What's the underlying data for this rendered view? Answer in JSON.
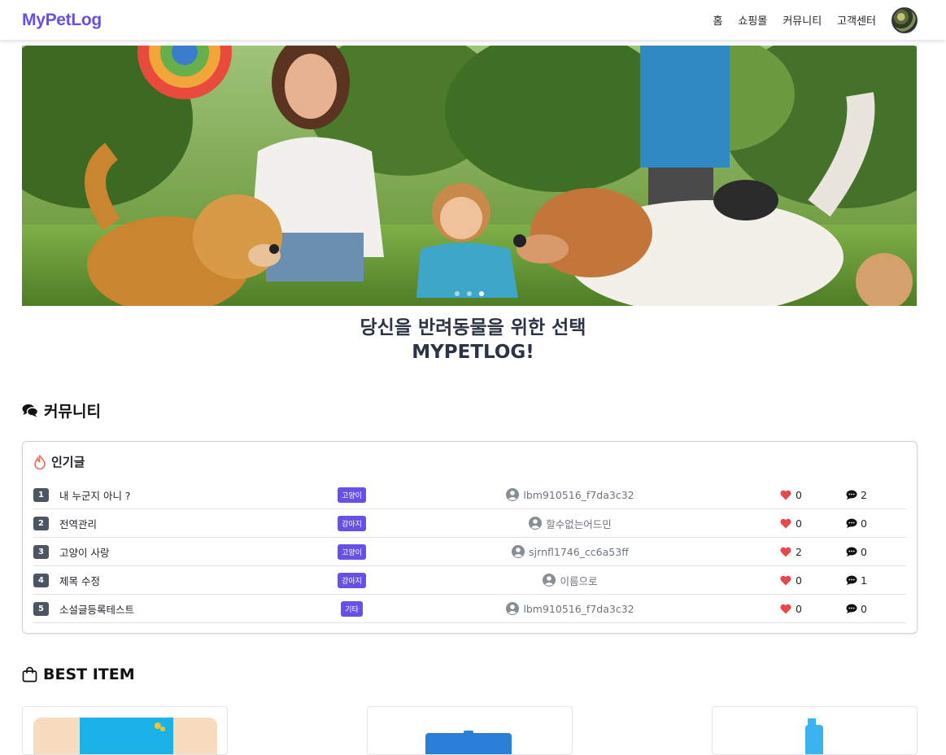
{
  "nav": {
    "brand": "MyPetLog",
    "links": [
      "홈",
      "쇼핑몰",
      "커뮤니티",
      "고객센터"
    ]
  },
  "hero": {
    "slide_count": 3,
    "active_slide": 3,
    "tagline_line1": "당신을 반려동물을 위한 선택",
    "tagline_line2": "MYPETLOG!"
  },
  "community": {
    "heading": "커뮤니티",
    "card_title": "인기글",
    "posts": [
      {
        "rank": "1",
        "title": "내 누군지 아니 ?",
        "category": "고양이",
        "author": "lbm910516_f7da3c32",
        "likes": "0",
        "comments": "2"
      },
      {
        "rank": "2",
        "title": "전역관리",
        "category": "강아지",
        "author": "할수없는어드민",
        "likes": "0",
        "comments": "0"
      },
      {
        "rank": "3",
        "title": "고양이 사랑",
        "category": "고양이",
        "author": "sjrnfl1746_cc6a53ff",
        "likes": "2",
        "comments": "0"
      },
      {
        "rank": "4",
        "title": "제목 수정",
        "category": "강아지",
        "author": "이름으로",
        "likes": "0",
        "comments": "1"
      },
      {
        "rank": "5",
        "title": "소설글등록테스트",
        "category": "기타",
        "author": "lbm910516_f7da3c32",
        "likes": "0",
        "comments": "0"
      }
    ]
  },
  "best": {
    "heading": "BEST ITEM"
  },
  "colors": {
    "brand": "#6650e6",
    "badge": "#6650e6",
    "heart": "#e5484d",
    "fire": "#f06a5a"
  },
  "icons": [
    "comments-icon",
    "fire-icon",
    "user-circle-icon",
    "heart-icon",
    "comment-icon",
    "shopping-bag-icon"
  ]
}
